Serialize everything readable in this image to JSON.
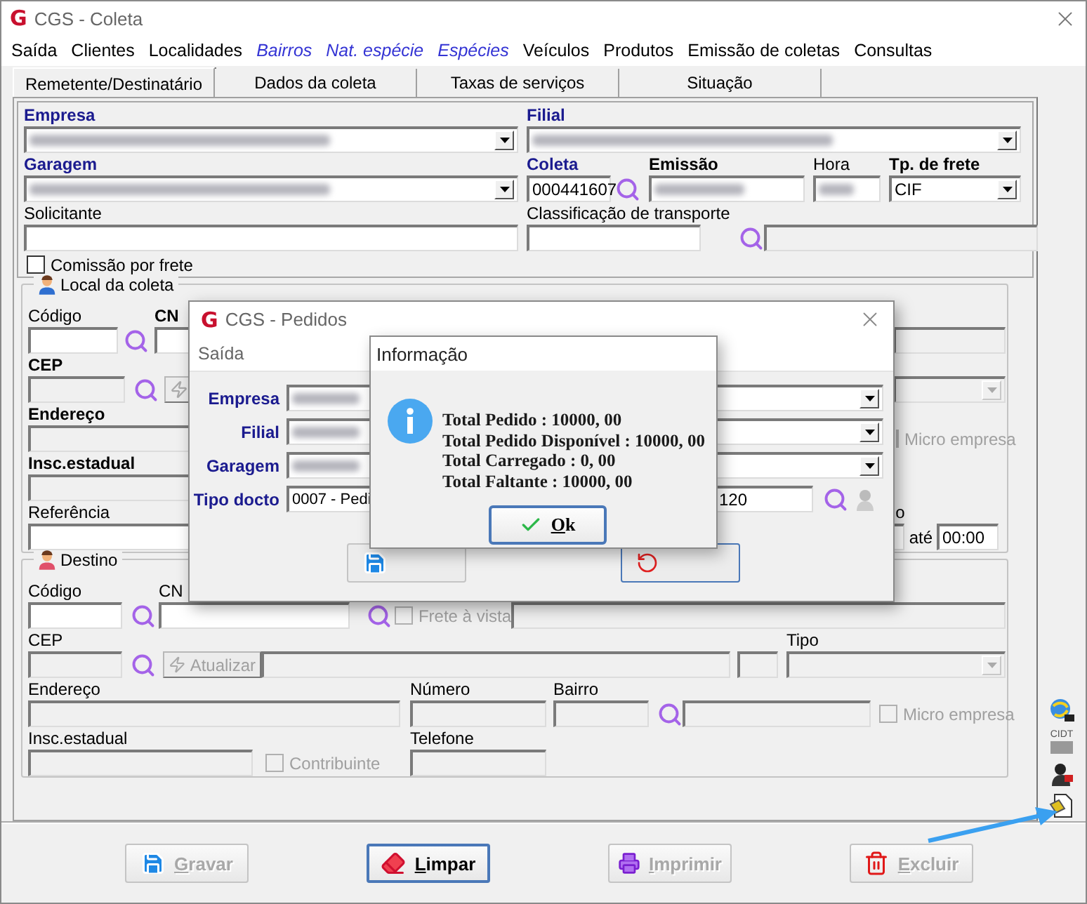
{
  "window": {
    "title": "CGS - Coleta",
    "logo": "G"
  },
  "menu": [
    {
      "label": "Saída",
      "kind": "plain"
    },
    {
      "label": "Clientes",
      "kind": "plain"
    },
    {
      "label": "Localidades",
      "kind": "plain"
    },
    {
      "label": "Bairros",
      "kind": "accent"
    },
    {
      "label": "Nat. espécie",
      "kind": "accent"
    },
    {
      "label": "Espécies",
      "kind": "accent"
    },
    {
      "label": "Veículos",
      "kind": "plain"
    },
    {
      "label": "Produtos",
      "kind": "plain"
    },
    {
      "label": "Emissão de coletas",
      "kind": "plain"
    },
    {
      "label": "Consultas",
      "kind": "plain"
    }
  ],
  "tabs": [
    {
      "label": "Remetente/Destinatário",
      "selected": true
    },
    {
      "label": "Dados da coleta",
      "selected": false
    },
    {
      "label": "Taxas de serviços",
      "selected": false
    },
    {
      "label": "Situação",
      "selected": false
    }
  ],
  "header": {
    "empresa": {
      "label": "Empresa",
      "required": true,
      "bold": true,
      "redacted": true
    },
    "filial": {
      "label": "Filial",
      "required": true,
      "bold": true,
      "redacted": true
    },
    "garagem": {
      "label": "Garagem",
      "required": true,
      "bold": true,
      "redacted": true
    },
    "coleta": {
      "label": "Coleta",
      "required": true,
      "bold": true,
      "value": "000441607"
    },
    "emissao": {
      "label": "Emissão",
      "bold": true,
      "redacted": true
    },
    "hora": {
      "label": "Hora",
      "redacted": true
    },
    "tp_frete": {
      "label": "Tp. de frete",
      "bold": true,
      "value": "CIF"
    },
    "solicitante": {
      "label": "Solicitante"
    },
    "classificacao": {
      "label": "Classificação de transporte"
    },
    "classificacao_descricao": {
      "disabled": true
    },
    "comissao": {
      "label": "Comissão por frete",
      "checked": false
    }
  },
  "local_coleta": {
    "title": "Local da coleta",
    "codigo": {
      "label": "Código"
    },
    "cnpj": {
      "label": "CN",
      "bold": true
    },
    "cnpj_extra": {
      "disabled": true
    },
    "cep": {
      "label": "CEP",
      "bold": true,
      "disabled": true
    },
    "atualizar": {
      "disabled": true
    },
    "tipo": {
      "disabled": true
    },
    "endereco": {
      "label": "Endereço",
      "bold": true,
      "disabled": true
    },
    "micro_empresa": {
      "label": "Micro empresa",
      "checked": false,
      "disabled": true
    },
    "insc_estadual": {
      "label": "Insc.estadual",
      "bold": true,
      "disabled": true
    },
    "referencia": {
      "label": "Referência"
    },
    "horario_de": {
      "label": "o"
    },
    "horario_ate": {
      "label": "até",
      "value": "00:00"
    }
  },
  "destino": {
    "title": "Destino",
    "codigo": {
      "label": "Código"
    },
    "cnpj": {
      "label": "CN"
    },
    "frete_vista": {
      "label": "Frete à vista",
      "checked": false,
      "disabled": true
    },
    "cnpj_extra": {
      "disabled": true
    },
    "cep": {
      "label": "CEP",
      "disabled": true
    },
    "atualizar": {
      "label": "Atualizar",
      "disabled": true
    },
    "cep_descricao": {
      "disabled": true
    },
    "cep_uf": {
      "disabled": true
    },
    "tipo": {
      "label": "Tipo",
      "disabled": true
    },
    "endereco": {
      "label": "Endereço",
      "disabled": true
    },
    "numero": {
      "label": "Número",
      "disabled": true
    },
    "bairro": {
      "label": "Bairro",
      "disabled": true
    },
    "bairro_nome": {
      "disabled": true
    },
    "micro_empresa": {
      "label": "Micro empresa",
      "checked": false,
      "disabled": true
    },
    "insc_estadual": {
      "label": "Insc.estadual",
      "disabled": true
    },
    "contribuinte": {
      "label": "Contribuinte",
      "checked": false,
      "disabled": true
    },
    "telefone": {
      "label": "Telefone",
      "disabled": true
    }
  },
  "side_tools": [
    {
      "kind": "globe"
    },
    {
      "kind": "card",
      "label": "CIDT"
    },
    {
      "kind": "person"
    },
    {
      "kind": "document"
    }
  ],
  "buttons": [
    {
      "label": "Gravar",
      "kind": "save",
      "disabled": true,
      "focused": false
    },
    {
      "label": "Limpar",
      "kind": "eraser",
      "disabled": false,
      "focused": true
    },
    {
      "label": "Imprimir",
      "kind": "printer",
      "disabled": true,
      "focused": false
    },
    {
      "label": "Excluir",
      "kind": "trash",
      "disabled": true,
      "focused": false
    }
  ],
  "pedidos_dialog": {
    "title": "CGS - Pedidos",
    "logo": "G",
    "menu": [
      "Saída"
    ],
    "fields": [
      {
        "label": "Empresa",
        "redacted": true
      },
      {
        "label": "Filial",
        "redacted": true
      },
      {
        "label": "Garagem",
        "redacted": true
      }
    ],
    "tipo_docto": {
      "label": "Tipo docto",
      "value": "0007 - Pedi",
      "value_end": "120"
    },
    "buttons": [
      {
        "kind": "save",
        "focused": false
      },
      {
        "kind": "cancel",
        "focused": true
      }
    ]
  },
  "info_dialog": {
    "title": "Informação",
    "lines": [
      "Total Pedido : 10000, 00",
      "Total Pedido Disponível : 10000, 00",
      "Total Carregado : 0, 00",
      "Total Faltante : 10000, 00"
    ],
    "ok": "Ok"
  }
}
